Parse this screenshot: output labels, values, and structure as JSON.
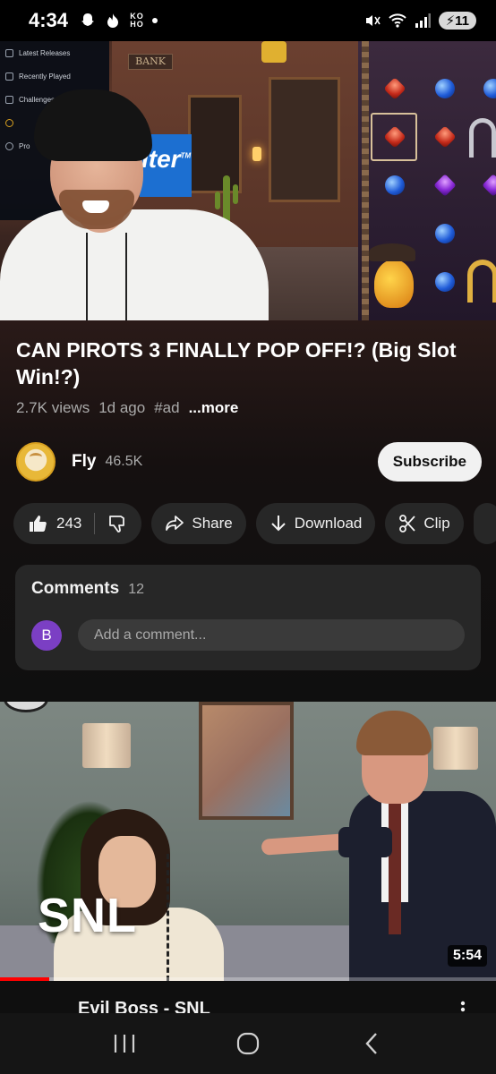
{
  "status_bar": {
    "time": "4:34",
    "ko_text": "KO\nHO",
    "battery": "11",
    "icons": [
      "snapchat-icon",
      "tinder-flame-icon",
      "ko-ho-icon",
      "notification-dot",
      "mute-icon",
      "wifi-icon",
      "signal-icon",
      "battery-icon"
    ]
  },
  "player": {
    "sidebar_items": [
      "Latest Releases",
      "Recently Played",
      "Challenges",
      "",
      "Pro"
    ],
    "bank_sign": "BANK",
    "ad_text": "Iter",
    "ad_tm": "TM"
  },
  "video": {
    "title": "CAN PIROTS 3 FINALLY POP OFF!? (Big Slot Win!?)",
    "views": "2.7K views",
    "age": "1d ago",
    "hashtag": "#ad",
    "more": "...more"
  },
  "channel": {
    "name": "Fly",
    "subscribers": "46.5K",
    "subscribe_label": "Subscribe"
  },
  "actions": {
    "like_count": "243",
    "share_label": "Share",
    "download_label": "Download",
    "clip_label": "Clip"
  },
  "comments": {
    "heading": "Comments",
    "count": "12",
    "user_initial": "B",
    "placeholder": "Add a comment..."
  },
  "next_video": {
    "logo": "SNL",
    "duration": "5:54",
    "title": "Evil Boss - SNL",
    "watch_progress": 0.1
  },
  "colors": {
    "background": "#0f0f0f",
    "pill": "#272727",
    "accent_red": "#ff0000",
    "comment_avatar": "#7b3fc4"
  }
}
